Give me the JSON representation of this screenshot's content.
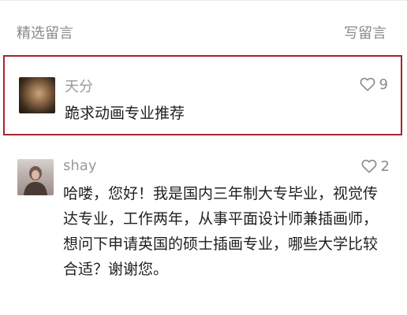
{
  "header": {
    "title": "精选留言",
    "write_label": "写留言"
  },
  "comments": [
    {
      "nickname": "天分",
      "likes": "9",
      "text": "跪求动画专业推荐",
      "avatar_icon": "cat-avatar"
    },
    {
      "nickname": "shay",
      "likes": "2",
      "text": "哈喽，您好！我是国内三年制大专毕业，视觉传达专业，工作两年，从事平面设计师兼插画师，想问下申请英国的硕士插画专业，哪些大学比较合适？谢谢您。",
      "avatar_icon": "person-avatar"
    }
  ],
  "colors": {
    "highlight_border": "#a4262c",
    "muted_text": "#8a8a8a",
    "body_text": "#1f1f1f"
  }
}
